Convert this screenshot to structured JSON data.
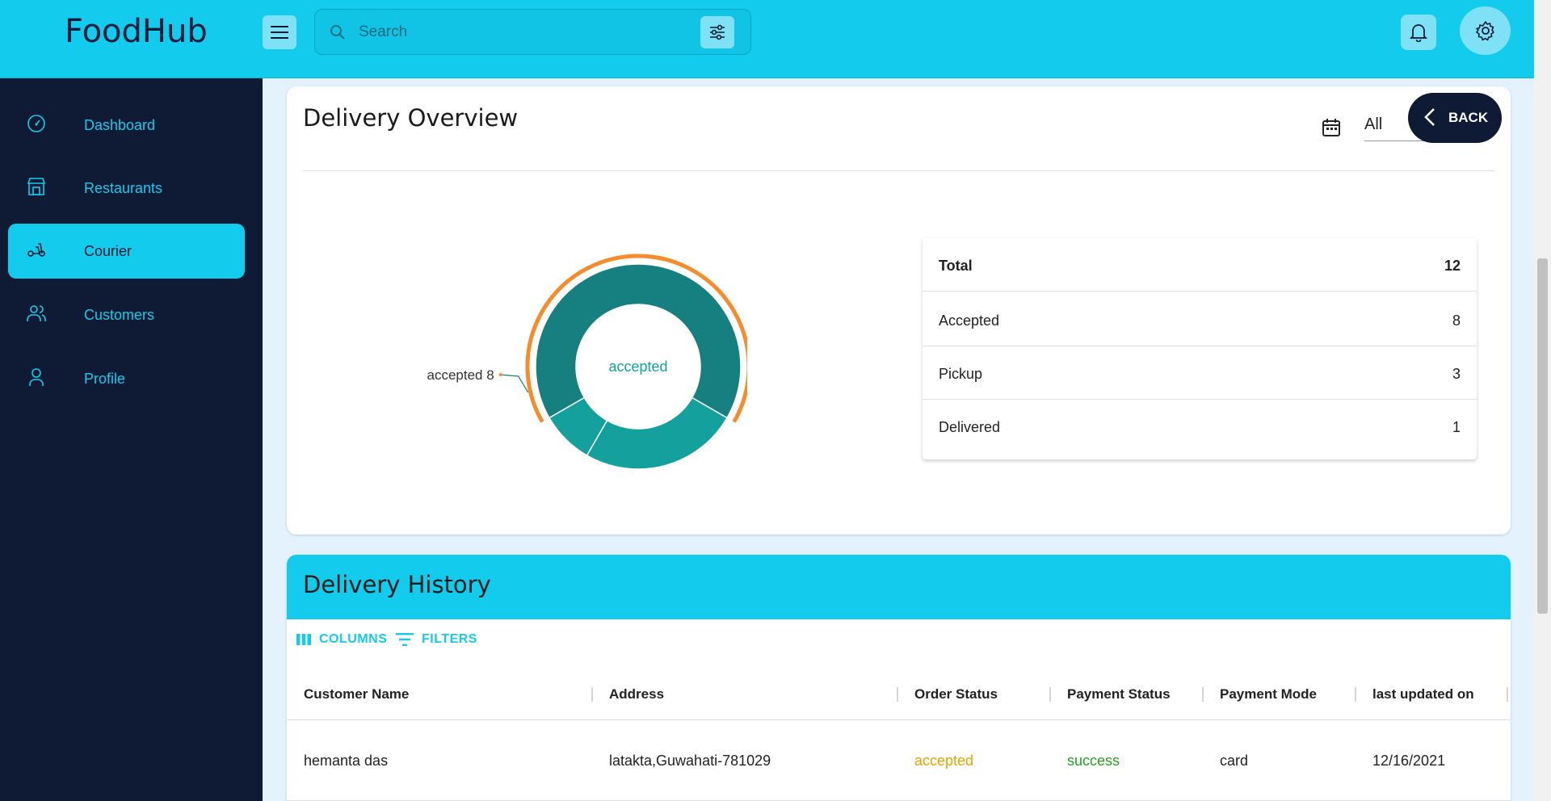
{
  "app": {
    "brand": "FoodHub"
  },
  "search": {
    "placeholder": "Search"
  },
  "sidebar": {
    "items": [
      {
        "label": "Dashboard",
        "icon": "speedometer-icon"
      },
      {
        "label": "Restaurants",
        "icon": "store-icon"
      },
      {
        "label": "Courier",
        "icon": "scooter-icon",
        "active": true
      },
      {
        "label": "Customers",
        "icon": "users-icon"
      },
      {
        "label": "Profile",
        "icon": "user-icon"
      }
    ]
  },
  "overview": {
    "title": "Delivery Overview",
    "date_filter": "All",
    "back_label": "BACK",
    "stats": [
      {
        "label": "Total",
        "value": "12"
      },
      {
        "label": "Accepted",
        "value": "8"
      },
      {
        "label": "Pickup",
        "value": "3"
      },
      {
        "label": "Delivered",
        "value": "1"
      }
    ]
  },
  "chart_data": {
    "type": "pie",
    "donut": true,
    "categories": [
      "accepted",
      "pickup",
      "delivered"
    ],
    "values": [
      8,
      3,
      1
    ],
    "center_label": "accepted",
    "callout": "accepted 8",
    "colors": {
      "accepted": "#168080",
      "pickup": "#14a19d",
      "delivered": "#14a19d",
      "highlight": "#f58d2e"
    }
  },
  "history": {
    "title": "Delivery History",
    "columns_label": "COLUMNS",
    "filters_label": "FILTERS",
    "headers": [
      "Customer Name",
      "Address",
      "Order Status",
      "Payment Status",
      "Payment Mode",
      "last updated on"
    ],
    "rows": [
      {
        "customer": "hemanta das",
        "address": "latakta,Guwahati-781029",
        "order_status": "accepted",
        "payment_status": "success",
        "payment_mode": "card",
        "updated": "12/16/2021"
      }
    ]
  },
  "colors": {
    "accent": "#13cced",
    "sidebar": "#0f1a34",
    "status_accepted": "#e8a300",
    "status_success": "#22a322"
  }
}
